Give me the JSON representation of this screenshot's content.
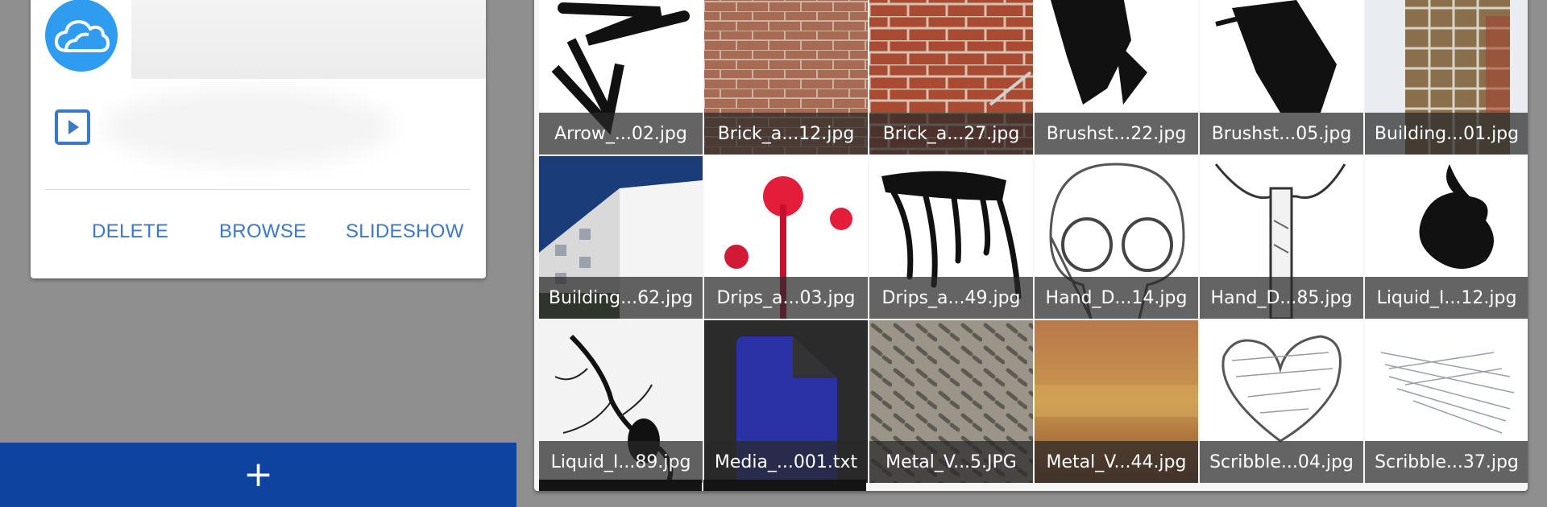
{
  "card": {
    "actions": {
      "delete": "DELETE",
      "browse": "BROWSE",
      "slideshow": "SLIDESHOW"
    },
    "icons": {
      "avatar": "cloud-icon",
      "media": "play-icon"
    },
    "accent_color": "#3b78c9",
    "avatar_color": "#2f9cf0"
  },
  "add_bar": {
    "label": "+",
    "color": "#0e44a0"
  },
  "files": [
    {
      "name": "Arrow_...02.jpg",
      "thumb": "arrow"
    },
    {
      "name": "Brick_a...12.jpg",
      "thumb": "brick"
    },
    {
      "name": "Brick_a...27.jpg",
      "thumb": "brick2"
    },
    {
      "name": "Brushst...22.jpg",
      "thumb": "brush1"
    },
    {
      "name": "Brushst...05.jpg",
      "thumb": "brush2"
    },
    {
      "name": "Building...01.jpg",
      "thumb": "building1"
    },
    {
      "name": "Building...62.jpg",
      "thumb": "building2"
    },
    {
      "name": "Drips_a...03.jpg",
      "thumb": "drips-red"
    },
    {
      "name": "Drips_a...49.jpg",
      "thumb": "drips-black"
    },
    {
      "name": "Hand_D...14.jpg",
      "thumb": "skull"
    },
    {
      "name": "Hand_D...85.jpg",
      "thumb": "axe"
    },
    {
      "name": "Liquid_I...12.jpg",
      "thumb": "ink1"
    },
    {
      "name": "Liquid_I...89.jpg",
      "thumb": "ink2"
    },
    {
      "name": "Media_...001.txt",
      "thumb": "file-icon"
    },
    {
      "name": "Metal_V...5.JPG",
      "thumb": "metal1"
    },
    {
      "name": "Metal_V...44.jpg",
      "thumb": "metal2"
    },
    {
      "name": "Scribble...04.jpg",
      "thumb": "heart-scribble"
    },
    {
      "name": "Scribble...37.jpg",
      "thumb": "scribble"
    }
  ]
}
